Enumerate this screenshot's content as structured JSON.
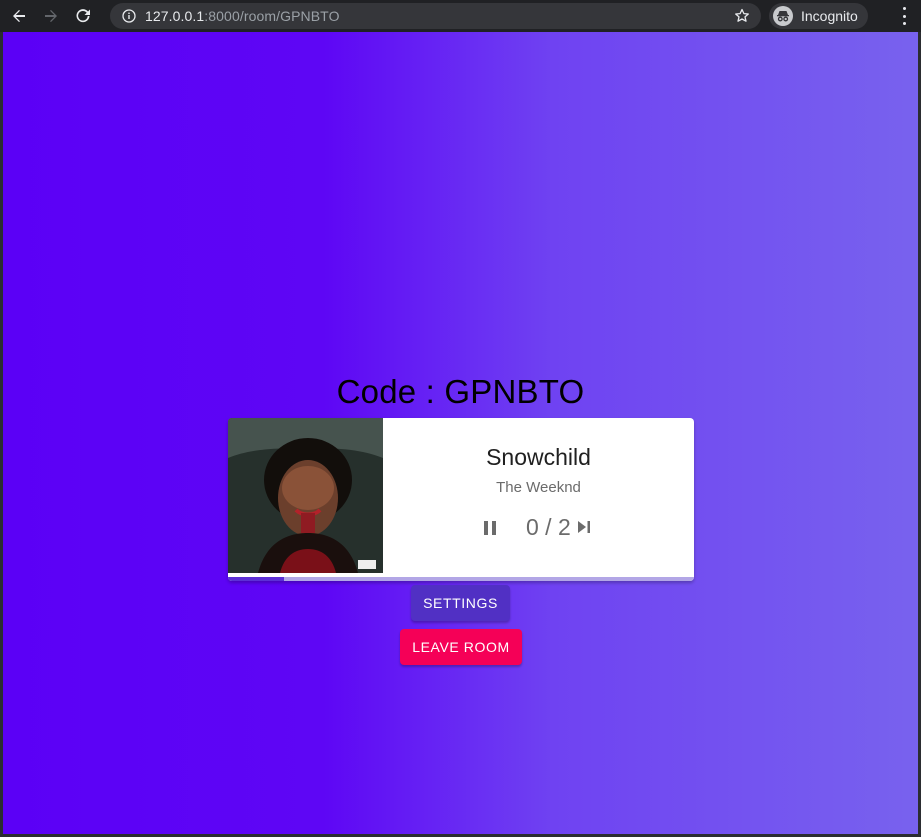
{
  "browser": {
    "url_host": "127.0.0.1",
    "url_path": ":8000/room/GPNBTO",
    "profile_label": "Incognito"
  },
  "room": {
    "code_label": "Code : GPNBTO"
  },
  "player": {
    "title": "Snowchild",
    "artist": "The Weeknd",
    "progress_count": "0 / 2",
    "track_progress": 0.12
  },
  "buttons": {
    "settings": "SETTINGS",
    "leave_room": "LEAVE ROOM"
  },
  "colors": {
    "bg_left": "#5b00f6",
    "bg_right": "#7862ee",
    "settings_button": "#5130c4",
    "leave_button": "#f50057"
  },
  "icons": {
    "back": "arrow-back-icon",
    "forward": "arrow-forward-icon",
    "reload": "reload-icon",
    "info": "info-icon",
    "star": "star-icon",
    "incognito": "incognito-icon",
    "menu": "kebab-menu-icon",
    "pause": "pause-icon",
    "skip": "skip-next-icon"
  }
}
